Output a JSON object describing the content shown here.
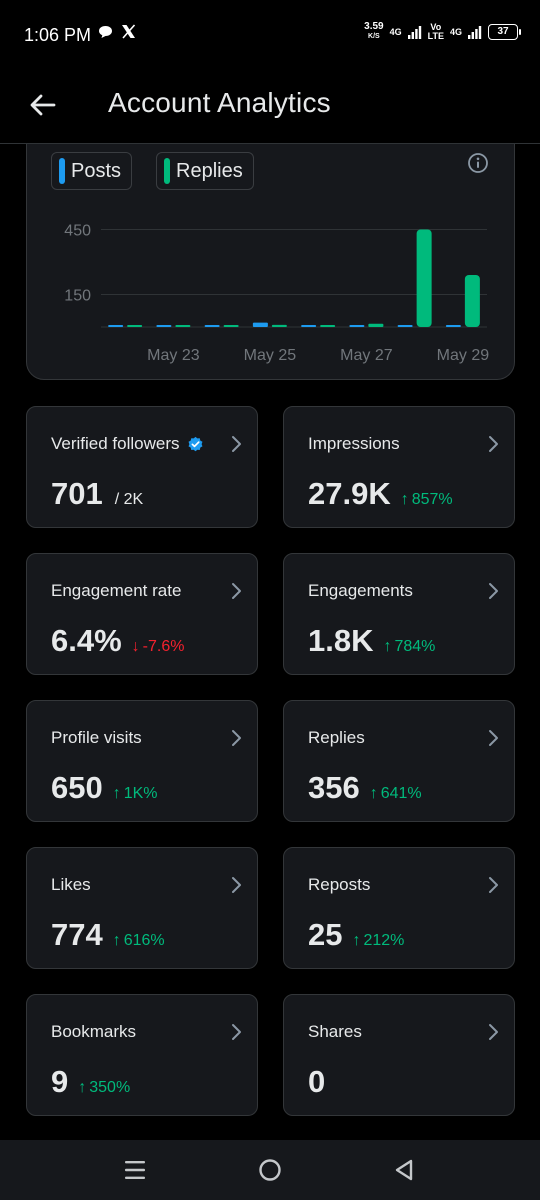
{
  "status_bar": {
    "time": "1:06 PM",
    "speed_value": "3.59",
    "speed_unit": "K/S",
    "network_1": "4G",
    "network_2_top": "Vo",
    "network_2_bottom": "LTE",
    "network_3": "4G",
    "battery": "37",
    "icons": [
      "chat-bubble-icon",
      "x-logo-icon",
      "signal-icon",
      "battery-icon"
    ]
  },
  "header": {
    "title": "Account Analytics",
    "back_icon": "back-arrow-icon"
  },
  "chart_legend": {
    "posts_label": "Posts",
    "replies_label": "Replies",
    "posts_color": "#1d9bf0",
    "replies_color": "#00ba7c"
  },
  "chart_data": {
    "type": "bar",
    "title": "",
    "xlabel": "",
    "ylabel": "",
    "y_ticks": [
      "450",
      "150"
    ],
    "x_ticks": [
      "May 23",
      "May 25",
      "May 27",
      "May 29"
    ],
    "categories": [
      "May 22",
      "May 23",
      "May 24",
      "May 25",
      "May 26",
      "May 27",
      "May 28",
      "May 29"
    ],
    "series": [
      {
        "name": "Posts",
        "color": "#1d9bf0",
        "values": [
          0,
          0,
          0,
          20,
          0,
          5,
          5,
          5
        ]
      },
      {
        "name": "Replies",
        "color": "#00ba7c",
        "values": [
          0,
          0,
          0,
          10,
          0,
          15,
          450,
          240
        ]
      }
    ],
    "ylim": [
      0,
      480
    ],
    "grid": true,
    "legend": "top-left"
  },
  "metrics": [
    {
      "label": "Verified followers",
      "value": "701",
      "suffix": "/ 2K",
      "change": "",
      "direction": "",
      "has_verified_icon": true
    },
    {
      "label": "Impressions",
      "value": "27.9K",
      "suffix": "",
      "change": "857%",
      "direction": "up"
    },
    {
      "label": "Engagement rate",
      "value": "6.4%",
      "suffix": "",
      "change": "-7.6%",
      "direction": "down"
    },
    {
      "label": "Engagements",
      "value": "1.8K",
      "suffix": "",
      "change": "784%",
      "direction": "up"
    },
    {
      "label": "Profile visits",
      "value": "650",
      "suffix": "",
      "change": "1K%",
      "direction": "up"
    },
    {
      "label": "Replies",
      "value": "356",
      "suffix": "",
      "change": "641%",
      "direction": "up"
    },
    {
      "label": "Likes",
      "value": "774",
      "suffix": "",
      "change": "616%",
      "direction": "up"
    },
    {
      "label": "Reposts",
      "value": "25",
      "suffix": "",
      "change": "212%",
      "direction": "up"
    },
    {
      "label": "Bookmarks",
      "value": "9",
      "suffix": "",
      "change": "350%",
      "direction": "up"
    },
    {
      "label": "Shares",
      "value": "0",
      "suffix": "",
      "change": "",
      "direction": ""
    }
  ],
  "nav": {
    "buttons": [
      "recent-apps-icon",
      "home-icon",
      "back-triangle-icon"
    ]
  }
}
